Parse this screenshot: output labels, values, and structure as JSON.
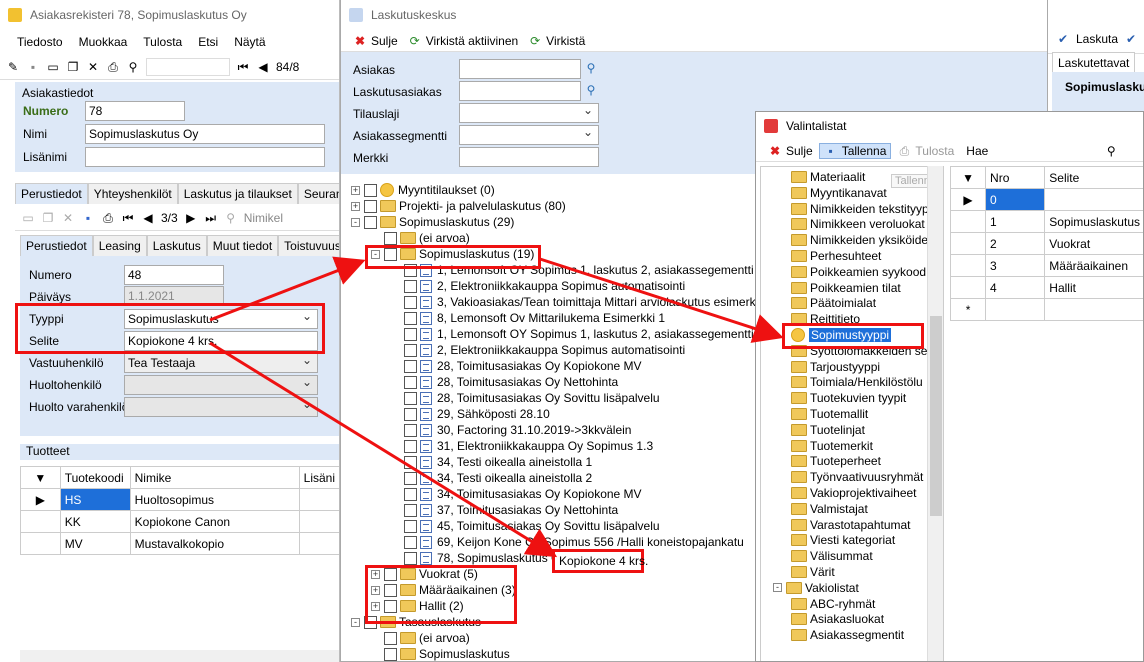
{
  "win1": {
    "title": "Asiakasrekisteri 78, Sopimuslaskutus Oy",
    "menu": [
      "Tiedosto",
      "Muokkaa",
      "Tulosta",
      "Etsi",
      "Näytä"
    ],
    "record_counter": "84/8",
    "section_title": "Asiakastiedot",
    "numero_label": "Numero",
    "numero_value": "78",
    "nimi_label": "Nimi",
    "nimi_value": "Sopimuslaskutus Oy",
    "lisanimi_label": "Lisänimi",
    "tabs": [
      "Perustiedot",
      "Yhteyshenkilöt",
      "Laskutus ja tilaukset",
      "Seurantakoht"
    ],
    "subtoolbar_counter": "3/3",
    "subtoolbar_search": "Nimikel",
    "subtabs": [
      "Perustiedot",
      "Leasing",
      "Laskutus",
      "Muut tiedot",
      "Toistuvuus",
      "La"
    ],
    "form": {
      "numero_label": "Numero",
      "numero_value": "48",
      "paivays_label": "Päiväys",
      "paivays_value": "1.1.2021",
      "tyyppi_label": "Tyyppi",
      "tyyppi_value": "Sopimuslaskutus",
      "selite_label": "Selite",
      "selite_value": "Kopiokone 4 krs.",
      "vastuu_label": "Vastuuhenkilö",
      "vastuu_value": "Tea Testaaja",
      "huolto_label": "Huoltohenkilö",
      "huoltovara_label": "Huolto varahenkilö"
    },
    "products_title": "Tuotteet",
    "products_headers": [
      "Tuotekoodi",
      "Nimike",
      "Lisäni"
    ],
    "products": [
      {
        "code": "HS",
        "name": "Huoltosopimus"
      },
      {
        "code": "KK",
        "name": "Kopiokone Canon"
      },
      {
        "code": "MV",
        "name": "Mustavalkokopio"
      }
    ]
  },
  "win2": {
    "title": "Laskutuskeskus",
    "toolbar": {
      "close": "Sulje",
      "refresh_active": "Virkistä aktiivinen",
      "refresh": "Virkistä"
    },
    "filters": {
      "asiakas": "Asiakas",
      "laskutusasiakas": "Laskutusasiakas",
      "tilauslaji": "Tilauslaji",
      "segmentti": "Asiakassegmentti",
      "merkki": "Merkki"
    },
    "tree": [
      {
        "t": "Myyntitilaukset (0)",
        "lvl": 0,
        "exp": "+",
        "icon": "circle"
      },
      {
        "t": "Projekti- ja palvelulaskutus (80)",
        "lvl": 0,
        "exp": "+",
        "icon": "folder"
      },
      {
        "t": "Sopimuslaskutus (29)",
        "lvl": 0,
        "exp": "-",
        "icon": "folder"
      },
      {
        "t": "(ei arvoa)",
        "lvl": 1,
        "exp": "",
        "icon": "folder"
      },
      {
        "t": "Sopimuslaskutus (19)",
        "lvl": 1,
        "exp": "-",
        "icon": "folder"
      },
      {
        "t": "1, Lemonsoft OY Sopimus 1, laskutus 2, asiakassegementti 1",
        "lvl": 2,
        "exp": "",
        "icon": "doc"
      },
      {
        "t": "2, Elektroniikkakauppa Sopimus automatisointi",
        "lvl": 2,
        "exp": "",
        "icon": "doc"
      },
      {
        "t": "3, Vakioasiakas/Tean toimittaja Mittari arviolaskutus esimerkki",
        "lvl": 2,
        "exp": "",
        "icon": "doc"
      },
      {
        "t": "8, Lemonsoft Ov Mittarilukema Esimerkki 1",
        "lvl": 2,
        "exp": "",
        "icon": "doc"
      },
      {
        "t": "1, Lemonsoft OY Sopimus 1, laskutus 2, asiakassegementti 1",
        "lvl": 2,
        "exp": "",
        "icon": "doc"
      },
      {
        "t": "2, Elektroniikkakauppa Sopimus automatisointi",
        "lvl": 2,
        "exp": "",
        "icon": "doc"
      },
      {
        "t": "28, Toimitusasiakas Oy Kopiokone MV",
        "lvl": 2,
        "exp": "",
        "icon": "doc"
      },
      {
        "t": "28, Toimitusasiakas Oy Nettohinta",
        "lvl": 2,
        "exp": "",
        "icon": "doc"
      },
      {
        "t": "28, Toimitusasiakas Oy Sovittu lisäpalvelu",
        "lvl": 2,
        "exp": "",
        "icon": "doc"
      },
      {
        "t": "29, Sähköposti 28.10",
        "lvl": 2,
        "exp": "",
        "icon": "doc"
      },
      {
        "t": "30, Factoring 31.10.2019->3kkvälein",
        "lvl": 2,
        "exp": "",
        "icon": "doc"
      },
      {
        "t": "31, Elektroniikkakauppa Oy Sopimus 1.3",
        "lvl": 2,
        "exp": "",
        "icon": "doc"
      },
      {
        "t": "34, Testi oikealla aineistolla 1",
        "lvl": 2,
        "exp": "",
        "icon": "doc"
      },
      {
        "t": "34, Testi oikealla aineistolla 2",
        "lvl": 2,
        "exp": "",
        "icon": "doc"
      },
      {
        "t": "34, Toimitusasiakas Oy Kopiokone MV",
        "lvl": 2,
        "exp": "",
        "icon": "doc"
      },
      {
        "t": "37, Toimitusasiakas Oy Nettohinta",
        "lvl": 2,
        "exp": "",
        "icon": "doc"
      },
      {
        "t": "45, Toimitusasiakas Oy Sovittu lisäpalvelu",
        "lvl": 2,
        "exp": "",
        "icon": "doc"
      },
      {
        "t": "69, Keijon Kone Oy Sopimus 556 /Halli koneistopajankatu",
        "lvl": 2,
        "exp": "",
        "icon": "doc"
      },
      {
        "t": "78, Sopimuslaskutus Oy",
        "lvl": 2,
        "exp": "",
        "icon": "doc"
      },
      {
        "t": "Vuokrat (5)",
        "lvl": 1,
        "exp": "+",
        "icon": "folder"
      },
      {
        "t": "Määräaikainen (3)",
        "lvl": 1,
        "exp": "+",
        "icon": "folder"
      },
      {
        "t": "Hallit (2)",
        "lvl": 1,
        "exp": "+",
        "icon": "folder"
      },
      {
        "t": "Tasauslaskutus",
        "lvl": 0,
        "exp": "-",
        "icon": "folder"
      },
      {
        "t": "(ei arvoa)",
        "lvl": 1,
        "exp": "",
        "icon": "folder"
      },
      {
        "t": "Sopimuslaskutus",
        "lvl": 1,
        "exp": "",
        "icon": "folder"
      }
    ],
    "callout": "Kopiokone 4 krs."
  },
  "win3": {
    "toolbar": {
      "laskuta": "Laskuta"
    },
    "tab": "Laskutettavat",
    "heading": "Sopimuslaskutu"
  },
  "win4": {
    "title": "Valintalistat",
    "toolbar": {
      "close": "Sulje",
      "save": "Tallenna",
      "print": "Tulosta",
      "search": "Hae"
    },
    "tooltip": "Tallenna",
    "tree": [
      {
        "t": "Materiaalit",
        "lvl": 1,
        "icon": "folder"
      },
      {
        "t": "Myyntikanavat",
        "lvl": 1,
        "icon": "folder"
      },
      {
        "t": "Nimikkeiden tekstityyp",
        "lvl": 1,
        "icon": "folder"
      },
      {
        "t": "Nimikkeen veroluokat",
        "lvl": 1,
        "icon": "folder"
      },
      {
        "t": "Nimikkeiden yksiköide",
        "lvl": 1,
        "icon": "folder"
      },
      {
        "t": "Perhesuhteet",
        "lvl": 1,
        "icon": "folder"
      },
      {
        "t": "Poikkeamien syykood",
        "lvl": 1,
        "icon": "folder"
      },
      {
        "t": "Poikkeamien tilat",
        "lvl": 1,
        "icon": "folder"
      },
      {
        "t": "Päätoimialat",
        "lvl": 1,
        "icon": "folder"
      },
      {
        "t": "Reittitieto",
        "lvl": 1,
        "icon": "folder"
      },
      {
        "t": "Sopimustyyppi",
        "lvl": 1,
        "icon": "circle",
        "sel": true
      },
      {
        "t": "Syöttölomakkeiden se",
        "lvl": 1,
        "icon": "folder"
      },
      {
        "t": "Tarjoustyyppi",
        "lvl": 1,
        "icon": "folder"
      },
      {
        "t": "Toimiala/Henkilöstölu",
        "lvl": 1,
        "icon": "folder"
      },
      {
        "t": "Tuotekuvien tyypit",
        "lvl": 1,
        "icon": "folder"
      },
      {
        "t": "Tuotemallit",
        "lvl": 1,
        "icon": "folder"
      },
      {
        "t": "Tuotelinjat",
        "lvl": 1,
        "icon": "folder"
      },
      {
        "t": "Tuotemerkit",
        "lvl": 1,
        "icon": "folder"
      },
      {
        "t": "Tuoteperheet",
        "lvl": 1,
        "icon": "folder"
      },
      {
        "t": "Työnvaativuusryhmät",
        "lvl": 1,
        "icon": "folder"
      },
      {
        "t": "Vakioprojektivaiheet",
        "lvl": 1,
        "icon": "folder"
      },
      {
        "t": "Valmistajat",
        "lvl": 1,
        "icon": "folder"
      },
      {
        "t": "Varastotapahtumat",
        "lvl": 1,
        "icon": "folder"
      },
      {
        "t": "Viesti kategoriat",
        "lvl": 1,
        "icon": "folder"
      },
      {
        "t": "Välisummat",
        "lvl": 1,
        "icon": "folder"
      },
      {
        "t": "Värit",
        "lvl": 1,
        "icon": "folder"
      },
      {
        "t": "Vakiolistat",
        "lvl": 0,
        "icon": "folder",
        "exp": "-"
      },
      {
        "t": "ABC-ryhmät",
        "lvl": 1,
        "icon": "folder"
      },
      {
        "t": "Asiakasluokat",
        "lvl": 1,
        "icon": "folder"
      },
      {
        "t": "Asiakassegmentit",
        "lvl": 1,
        "icon": "folder"
      }
    ],
    "grid_headers": [
      "Nro",
      "Selite"
    ],
    "grid_rows": [
      {
        "nro": "0",
        "selite": ""
      },
      {
        "nro": "1",
        "selite": "Sopimuslaskutus"
      },
      {
        "nro": "2",
        "selite": "Vuokrat"
      },
      {
        "nro": "3",
        "selite": "Määräaikainen"
      },
      {
        "nro": "4",
        "selite": "Hallit"
      }
    ]
  },
  "colors": {
    "highlight": "#e11111",
    "panel": "#dde8f7",
    "selection": "#1e6fd9"
  }
}
